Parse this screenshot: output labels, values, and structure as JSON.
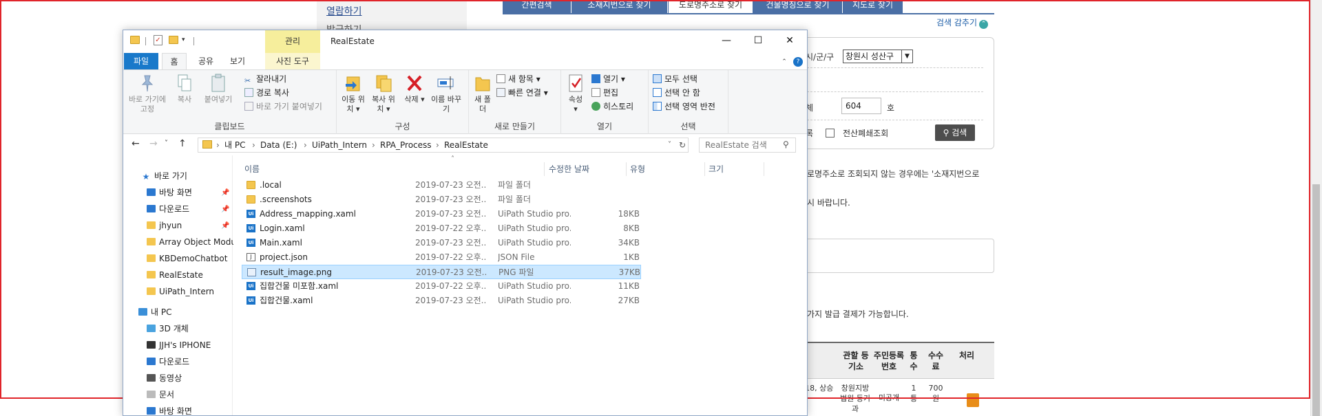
{
  "background_page": {
    "left_links": [
      "열람하기",
      "발급하기"
    ],
    "tabs": [
      "간편검색",
      "소재지번으로 찾기",
      "도로명주소로 찾기",
      "건물명칭으로 찾기",
      "지도로 찾기"
    ],
    "search_fold": "검색 감추기",
    "labels": {
      "city": "시/군/구",
      "ho": "호",
      "include_closed": "전산폐쇄조회",
      "unit_prefix": "체",
      "row_prefix": "록"
    },
    "city_select": "창원시 성산구",
    "ho_value": "604",
    "search_button": "검색",
    "notice1": "로명주소로 조회되지 않는 경우에는 '소재지번으로",
    "notice2": "시 바랍니다.",
    "notice3": "가지 발급 결제가 가능합니다.",
    "table_headers": [
      "관할 등기소",
      "주민등록번호",
      "통수",
      "수수료",
      "처리"
    ],
    "table_row": {
      "address_frag": "길 18, 상승",
      "office": "창원지방법원 등기과",
      "resident": "미공개",
      "count": "1통",
      "fee": "700원"
    }
  },
  "explorer": {
    "title": "RealEstate",
    "manage_tab": "관리",
    "ribbon_tabs": {
      "file": "파일",
      "home": "홈",
      "share": "공유",
      "view": "보기",
      "picture_tools": "사진 도구"
    },
    "clipboard": {
      "pin": "바로 가기에 고정",
      "copy": "복사",
      "paste": "붙여넣기",
      "cut": "잘라내기",
      "copy_path": "경로 복사",
      "paste_shortcut": "바로 가기 붙여넣기",
      "label": "클립보드"
    },
    "organize": {
      "move_to": "이동 위치",
      "copy_to": "복사 위치",
      "delete": "삭제",
      "rename": "이름 바꾸기",
      "label": "구성"
    },
    "new": {
      "new_folder": "새 폴더",
      "new_item": "새 항목",
      "easy_access": "빠른 연결",
      "label": "새로 만들기"
    },
    "open": {
      "properties": "속성",
      "open": "열기",
      "edit": "편집",
      "history": "히스토리",
      "label": "열기"
    },
    "select": {
      "select_all": "모두 선택",
      "select_none": "선택 안 함",
      "invert": "선택 영역 반전",
      "label": "선택"
    },
    "breadcrumb": [
      "내 PC",
      "Data (E:)",
      "UiPath_Intern",
      "RPA_Process",
      "RealEstate"
    ],
    "search_placeholder": "RealEstate 검색",
    "nav": {
      "quick_access": "바로 가기",
      "quick_items": [
        "바탕 화면",
        "다운로드",
        "jhyun",
        "Array Object Modu",
        "KBDemoChatbot",
        "RealEstate",
        "UiPath_Intern"
      ],
      "this_pc": "내 PC",
      "pc_items": [
        "3D 개체",
        "JJH's IPHONE",
        "다운로드",
        "동영상",
        "문서",
        "바탕 화면"
      ]
    },
    "columns": [
      "이름",
      "수정한 날짜",
      "유형",
      "크기"
    ],
    "files": [
      {
        "name": ".local",
        "date": "2019-07-23 오전...",
        "type": "파일 폴더",
        "size": "",
        "icon": "folder-icon"
      },
      {
        "name": ".screenshots",
        "date": "2019-07-23 오전...",
        "type": "파일 폴더",
        "size": "",
        "icon": "folder-icon"
      },
      {
        "name": "Address_mapping.xaml",
        "date": "2019-07-23 오전...",
        "type": "UiPath Studio pro...",
        "size": "18KB",
        "icon": "uipath-xaml-icon"
      },
      {
        "name": "Login.xaml",
        "date": "2019-07-22 오후...",
        "type": "UiPath Studio pro...",
        "size": "8KB",
        "icon": "uipath-xaml-icon"
      },
      {
        "name": "Main.xaml",
        "date": "2019-07-23 오전...",
        "type": "UiPath Studio pro...",
        "size": "34KB",
        "icon": "uipath-xaml-icon"
      },
      {
        "name": "project.json",
        "date": "2019-07-22 오후...",
        "type": "JSON File",
        "size": "1KB",
        "icon": "json-file-icon"
      },
      {
        "name": "result_image.png",
        "date": "2019-07-23 오전...",
        "type": "PNG 파일",
        "size": "37KB",
        "icon": "png-file-icon"
      },
      {
        "name": "집합건물 미포함.xaml",
        "date": "2019-07-22 오후...",
        "type": "UiPath Studio pro...",
        "size": "11KB",
        "icon": "uipath-xaml-icon"
      },
      {
        "name": "집합건물.xaml",
        "date": "2019-07-23 오전...",
        "type": "UiPath Studio pro...",
        "size": "27KB",
        "icon": "uipath-xaml-icon"
      }
    ],
    "selected_index": 6
  }
}
